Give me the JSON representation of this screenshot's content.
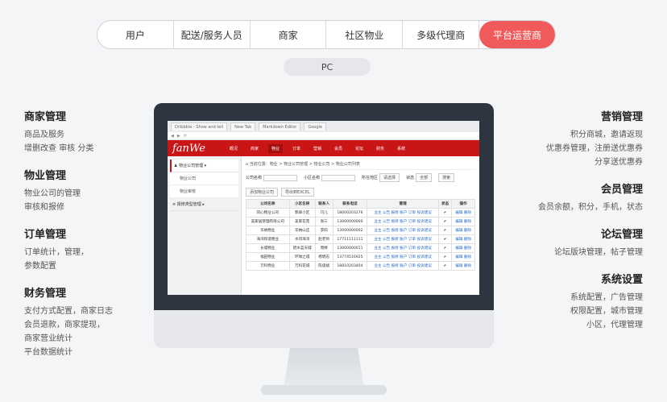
{
  "tabs": [
    "用户",
    "配送/服务人员",
    "商家",
    "社区物业",
    "多级代理商",
    "平台运营商"
  ],
  "active_tab": "平台运营商",
  "pc_label": "PC",
  "left_groups": [
    {
      "title": "商家管理",
      "lines": [
        "商品及服务",
        "增删改查 审核 分类"
      ]
    },
    {
      "title": "物业管理",
      "lines": [
        "物业公司的管理",
        "审核和报修"
      ]
    },
    {
      "title": "订单管理",
      "lines": [
        "订单统计，管理，",
        "参数配置"
      ]
    },
    {
      "title": "财务管理",
      "lines": [
        "支付方式配置，商家日志",
        "会员退款，商家提现，",
        "商家营业统计",
        "平台数据统计"
      ]
    }
  ],
  "right_groups": [
    {
      "title": "营销管理",
      "lines": [
        "积分商城，邀请返现",
        "优惠券管理，注册送优惠券",
        "分享送优惠券"
      ]
    },
    {
      "title": "会员管理",
      "lines": [
        "会员余额，积分，手机，状态"
      ]
    },
    {
      "title": "论坛管理",
      "lines": [
        "论坛版块管理，帖子管理"
      ]
    },
    {
      "title": "系统设置",
      "lines": [
        "系统配置，广告管理",
        "权限配置，城市管理",
        "小区，代理管理"
      ]
    }
  ],
  "app": {
    "logo": "fanWe",
    "browser_tabs": [
      "Dribbble - Show and tell",
      "New Tab",
      "Markdown Editor",
      "Google"
    ],
    "nav": [
      "概况",
      "商家",
      "物业",
      "订单",
      "营销",
      "会员",
      "论坛",
      "财务",
      "系统"
    ],
    "active_nav": "物业",
    "sidebar": {
      "group1": "物业公司管理",
      "sub": [
        "物业公司",
        "物业审核"
      ],
      "group2": "报修类型管理"
    },
    "breadcrumb": "当前位置：物业 > 物业公司管理 > 物业公司 > 物业公司列表",
    "form": {
      "company_label": "公司名称",
      "community_label": "小区名称",
      "area_label": "所在地区",
      "status_label": "状态",
      "province": "请选择",
      "status_val": "全部",
      "search": "搜索"
    },
    "add_btn": "添加物业公司",
    "export_btn": "导出到EXCEL",
    "columns": [
      "公司名称",
      "小区名称",
      "联系人",
      "联系电话",
      "管理",
      "状态",
      "操作"
    ],
    "rows": [
      [
        "同心物业公司",
        "翡翠小区",
        "巧儿",
        "18000203276",
        "业主 公告 报修 账户 订单 投诉建议",
        "✔",
        "编辑 删除"
      ],
      [
        "美家居管理有限公司",
        "美家花苑",
        "张三",
        "13000000000",
        "业主 公告 报修 账户 订单 投诉建议",
        "✔",
        "编辑 删除"
      ],
      [
        "华纳物业",
        "华纳山庄",
        "李四",
        "13000000002",
        "业主 公告 报修 账户 订单 投诉建议",
        "✔",
        "编辑 删除"
      ],
      [
        "海湾和谐物业",
        "水印海湾",
        "赵老师",
        "17711111111",
        "业主 公告 报修 账户 订单 投诉建议",
        "✔",
        "编辑 删除"
      ],
      [
        "长城物业",
        "碧水蓝天城",
        "周婷",
        "13000000011",
        "业主 公告 报修 账户 订单 投诉建议",
        "✔",
        "编辑 删除"
      ],
      [
        "福田物业",
        "环球之城",
        "杨明志",
        "13774516925",
        "业主 公告 报修 账户 订单 投诉建议",
        "✔",
        "编辑 删除"
      ],
      [
        "万科物业",
        "万科花城",
        "陈俊斌",
        "18810203404",
        "业主 公告 报修 账户 订单 投诉建议",
        "✔",
        "编辑 删除"
      ]
    ]
  }
}
